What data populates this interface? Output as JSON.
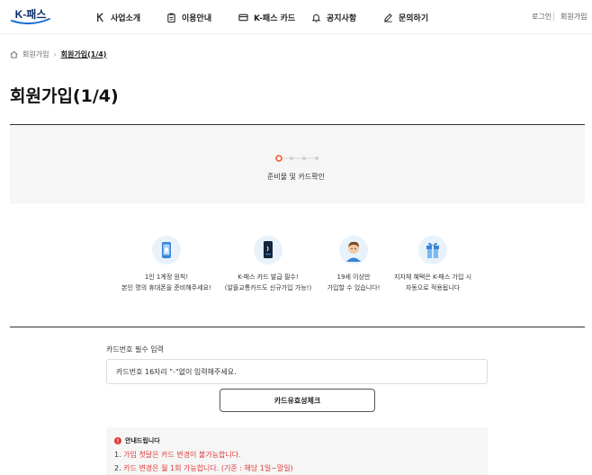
{
  "header": {
    "logo_text": "K-패스",
    "nav": [
      {
        "label": "사업소개",
        "icon": "k-logo-icon"
      },
      {
        "label": "이용안내",
        "icon": "clipboard-icon"
      },
      {
        "label": "K-패스 카드",
        "icon": "card-icon"
      },
      {
        "label": "공지사항",
        "icon": "bell-icon"
      },
      {
        "label": "문의하기",
        "icon": "pencil-icon"
      }
    ],
    "login_label": "로그인",
    "signup_label": "회원가입"
  },
  "breadcrumb": {
    "home_icon": "home-icon",
    "parent": "회원가입",
    "current": "회원가입(1/4)"
  },
  "page_title": "회원가입(1/4)",
  "stepper": {
    "total_steps": 4,
    "current_step": 1,
    "label": "준비물 및 카드확인",
    "active_color": "#f05a28"
  },
  "features": [
    {
      "icon": "phone-icon",
      "line1": "1인 1계정 원칙!",
      "line2": "본인 명의 휴대폰을 준비해주세요!"
    },
    {
      "icon": "card-icon",
      "line1": "K-패스 카드 발급 필수!",
      "line2": "(알뜰교통카드도 신규가입 가능!)"
    },
    {
      "icon": "person-icon",
      "line1": "19세 이상만",
      "line2": "가입할 수 있습니다!"
    },
    {
      "icon": "gift-icon",
      "line1": "지자체 혜택은 K-패스 가입 시",
      "line2": "자동으로 적용됩니다"
    }
  ],
  "form": {
    "label": "카드번호 필수 입력",
    "card_placeholder": "카드번호 16자리 \"-\"없이 입력해주세요.",
    "check_button": "카드유효성체크"
  },
  "notice": {
    "title": "안내드립니다",
    "items": [
      {
        "num": "1.",
        "text": "가입 첫달은 카드 변경이 불가능합니다."
      },
      {
        "num": "2.",
        "text": "카드 변경은 월 1회 가능합니다. (기준 : 해당 1일~말일)"
      }
    ],
    "accent_color": "#e03a3a"
  }
}
